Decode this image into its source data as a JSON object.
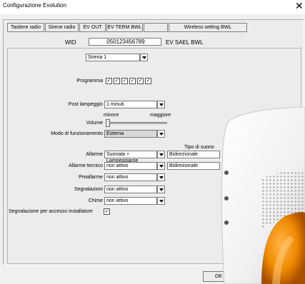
{
  "window": {
    "title": "Configurazione Evolution",
    "close_glyph": "✕"
  },
  "tabs": [
    "Tastiere radio",
    "Sirene radio",
    "EV OUT",
    "EV TERM BWL",
    "",
    "Wireless setting BWL"
  ],
  "wid": {
    "label": "WID",
    "value": "050123456789",
    "type_label": "EV SAEL BWL"
  },
  "device_select": {
    "value": "Sirena 1"
  },
  "programma": {
    "label": "Programma",
    "checks": [
      true,
      true,
      true,
      true,
      true,
      true
    ],
    "check_glyph": "✓"
  },
  "post_lampeggio": {
    "label": "Post lampeggio",
    "value": "1 minuti"
  },
  "volume": {
    "label": "Volume",
    "min_label": "minore",
    "max_label": "maggiore",
    "level": 0
  },
  "modo": {
    "label": "Modo di funzionamento",
    "value": "Esterna"
  },
  "tipo_suono_header": "Tipo di suono",
  "rows": [
    {
      "label": "Allarme",
      "value": "Suonata + Lampeggiante",
      "sound": "Bidirezionale"
    },
    {
      "label": "Allarme tecnico",
      "value": "non attivo",
      "sound": "Bidirezionale"
    },
    {
      "label": "Preallarme",
      "value": "non attivo"
    },
    {
      "label": "Segnalazioni",
      "value": "non attivo"
    },
    {
      "label": "Chime",
      "value": "non attivo"
    }
  ],
  "installer": {
    "label": "Segnalazione per accesso installatore",
    "checked": true
  },
  "buttons": {
    "ok": "OK"
  },
  "colors": {
    "siren_body": "#f4f4f4",
    "siren_lens": "#f08a00"
  }
}
